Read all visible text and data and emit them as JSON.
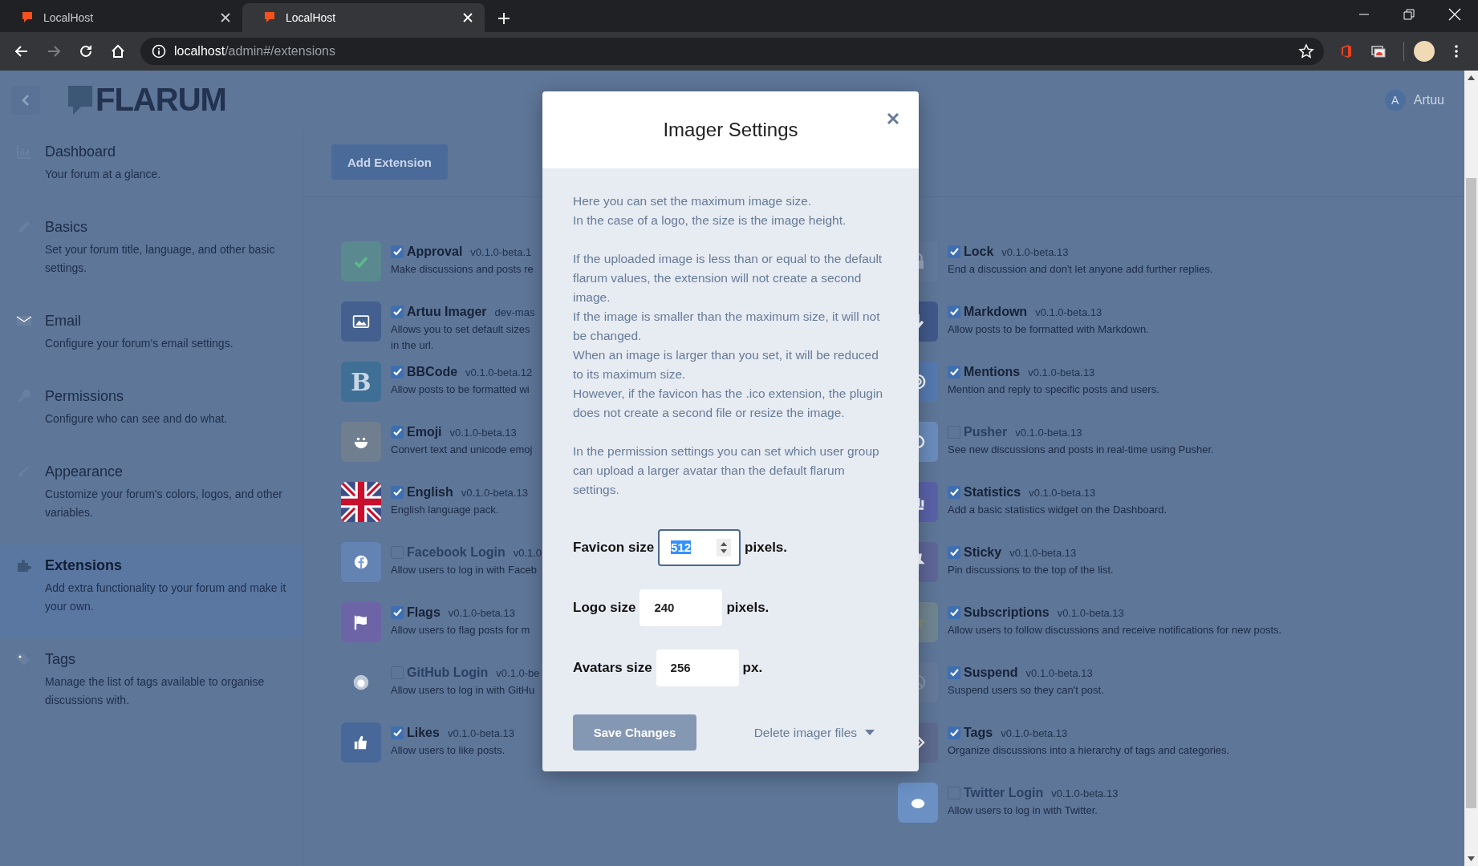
{
  "browser": {
    "tabs": [
      {
        "title": "LocalHost",
        "selected": false
      },
      {
        "title": "LocalHost",
        "selected": true
      }
    ],
    "address": {
      "host": "localhost",
      "path": "/admin#/extensions"
    }
  },
  "header": {
    "logo": "FLARUM",
    "user": {
      "initial": "A",
      "name": "Artuu"
    }
  },
  "sidebar": {
    "items": [
      {
        "title": "Dashboard",
        "description": "Your forum at a glance.",
        "selected": false
      },
      {
        "title": "Basics",
        "description": "Set your forum title, language, and other basic settings.",
        "selected": false
      },
      {
        "title": "Email",
        "description": "Configure your forum's email settings.",
        "selected": false
      },
      {
        "title": "Permissions",
        "description": "Configure who can see and do what.",
        "selected": false
      },
      {
        "title": "Appearance",
        "description": "Customize your forum's colors, logos, and other variables.",
        "selected": false
      },
      {
        "title": "Extensions",
        "description": "Add extra functionality to your forum and make it your own.",
        "selected": true
      },
      {
        "title": "Tags",
        "description": "Manage the list of tags available to organise discussions with.",
        "selected": false
      }
    ]
  },
  "extensions": {
    "add_button": "Add Extension",
    "columns": [
      [
        {
          "name": "Approval",
          "version": "v0.1.0-beta.1",
          "description": "Make discussions and posts re",
          "enabled": true,
          "color": "#5a8a8f"
        },
        {
          "name": "Artuu Imager",
          "version": "dev-mas",
          "description": "Allows you to set default sizes\nin the url.",
          "enabled": true,
          "color": "#44608f"
        },
        {
          "name": "BBCode",
          "version": "v0.1.0-beta.12",
          "description": "Allow posts to be formatted wi",
          "enabled": true,
          "color": "#3f6f95",
          "glyph": "B"
        },
        {
          "name": "Emoji",
          "version": "v0.1.0-beta.13",
          "description": "Convert text and unicode emoj",
          "enabled": true,
          "color": "#6f7f8f"
        },
        {
          "name": "English",
          "version": "v0.1.0-beta.13",
          "description": "English language pack.",
          "enabled": true,
          "color": "#3d4f8a"
        },
        {
          "name": "Facebook Login",
          "version": "v0.1.0",
          "description": "Allow users to log in with Faceb",
          "enabled": false,
          "color": "#6383b3"
        },
        {
          "name": "Flags",
          "version": "v0.1.0-beta.13",
          "description": "Allow users to flag posts for m",
          "enabled": true,
          "color": "#6d64a8"
        },
        {
          "name": "GitHub Login",
          "version": "v0.1.0-be",
          "description": "Allow users to log in with GitHu",
          "enabled": false
        },
        {
          "name": "Likes",
          "version": "v0.1.0-beta.13",
          "description": "Allow users to like posts.",
          "enabled": true,
          "color": "#48689a"
        }
      ],
      [
        {
          "name": "Lock",
          "version": "v0.1.0-beta.13",
          "description": "End a discussion and don't let anyone add further replies.",
          "enabled": true,
          "color": "#62799b"
        },
        {
          "name": "Markdown",
          "version": "v0.1.0-beta.13",
          "description": "Allow posts to be formatted with Markdown.",
          "enabled": true,
          "color": "#40598a"
        },
        {
          "name": "Mentions",
          "version": "v0.1.0-beta.13",
          "description": "Mention and reply to specific posts and users.",
          "enabled": true,
          "color": "#547ab0"
        },
        {
          "name": "Pusher",
          "version": "v0.1.0-beta.13",
          "description": "See new discussions and posts in real-time using Pusher.",
          "enabled": false,
          "color": "#6a8cbc"
        },
        {
          "name": "Statistics",
          "version": "v0.1.0-beta.13",
          "description": "Add a basic statistics widget on the Dashboard.",
          "enabled": true,
          "color": "#5962a8"
        },
        {
          "name": "Sticky",
          "version": "v0.1.0-beta.13",
          "description": "Pin discussions to the top of the list.",
          "enabled": true,
          "color": "#5f6698"
        },
        {
          "name": "Subscriptions",
          "version": "v0.1.0-beta.13",
          "description": "Allow users to follow discussions and receive notifications for new posts.",
          "enabled": true,
          "color": "#6f8590"
        },
        {
          "name": "Suspend",
          "version": "v0.1.0-beta.13",
          "description": "Suspend users so they can't post.",
          "enabled": true,
          "color": "#66799a"
        },
        {
          "name": "Tags",
          "version": "v0.1.0-beta.13",
          "description": "Organize discussions into a hierarchy of tags and categories.",
          "enabled": true,
          "color": "#5d6a8e"
        },
        {
          "name": "Twitter Login",
          "version": "v0.1.0-beta.13",
          "description": "Allow users to log in with Twitter.",
          "enabled": false,
          "color": "#6a90c4"
        }
      ]
    ]
  },
  "modal": {
    "title": "Imager Settings",
    "paragraphs": [
      "Here you can set the maximum image size.\nIn the case of a logo, the size is the image height.",
      "If the uploaded image is less than or equal to the default flarum values, the extension will not create a second image.\nIf the image is smaller than the maximum size, it will not be changed.\nWhen an image is larger than you set, it will be reduced to its maximum size.\nHowever, if the favicon has the .ico extension, the plugin does not create a second file or resize the image.",
      "In the permission settings you can set which user group can upload a larger avatar than the default flarum settings."
    ],
    "fields": [
      {
        "label": "Favicon size",
        "value": "512",
        "unit": "pixels.",
        "focused": true
      },
      {
        "label": "Logo size",
        "value": "240",
        "unit": "pixels.",
        "focused": false
      },
      {
        "label": "Avatars size",
        "value": "256",
        "unit": "px.",
        "focused": false
      }
    ],
    "save_button": "Save Changes",
    "delete_menu": "Delete imager files"
  }
}
